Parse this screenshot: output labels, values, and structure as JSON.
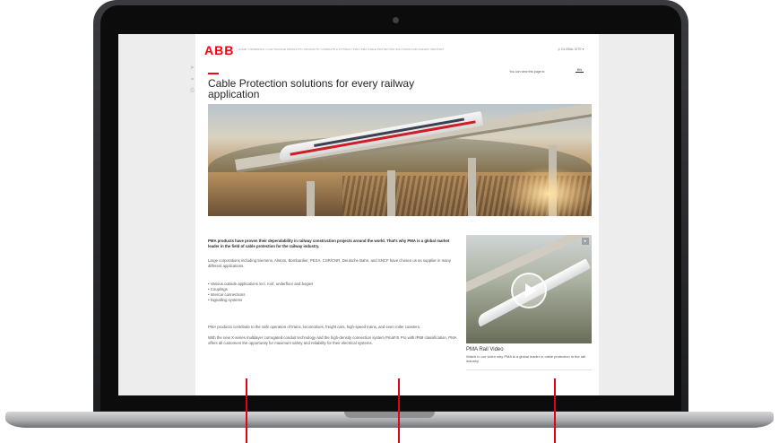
{
  "site": {
    "logo": "ABB",
    "breadcrumb": "HOME / OFFERINGS / LOW VOLTAGE PRODUCTS / PRODUCTS / CONDUITS & FITTINGS / PMA / PMA CABLE PROTECTION SOLUTIONS FOR RAILWAY INDUSTRY",
    "global_menu": "GLOBAL SITE",
    "side_icons": [
      "share-icon",
      "link-icon",
      "print-icon"
    ]
  },
  "page": {
    "title": "Cable Protection solutions for every railway application",
    "language_note": "You can view this page in:",
    "language_button": "EN"
  },
  "content": {
    "intro": "PMA products have proven their dependability in railway construction projects around the world. That's why PMA is a global market leader in the field of cable protection for the railway industry.",
    "para1": "Large corporations including Siemens, Alstom, Bombardier, PESA, CSR/CNR, Deutsche Bahn, and SNCF have chosen us as supplier in many different applications.",
    "bullets": [
      "• Various outside applications incl. roof, underfloor and bogies",
      "• Couplings",
      "• Intercar connections",
      "• Signalling systems"
    ],
    "para2": "PMA products contribute to the safe operation of trains, locomotives, freight cars, high-speed trains, and even roller coasters.",
    "para3": "With the new X-series multilayer corrugated conduit technology and the high-density connection system PmaFIX Pro with IP68 classification, PMA offers all customers the opportunity for maximum safety and reliability for their electrical systems."
  },
  "video": {
    "title": "PMA Rail Video",
    "description": "Watch in our video why PMA is a global leader in cable protection in the rail industry",
    "play_icon": "play-icon"
  },
  "colors": {
    "brand_red": "#ff000f",
    "callout_red": "#e2001a",
    "laptop_body": "#1c1d1f"
  }
}
